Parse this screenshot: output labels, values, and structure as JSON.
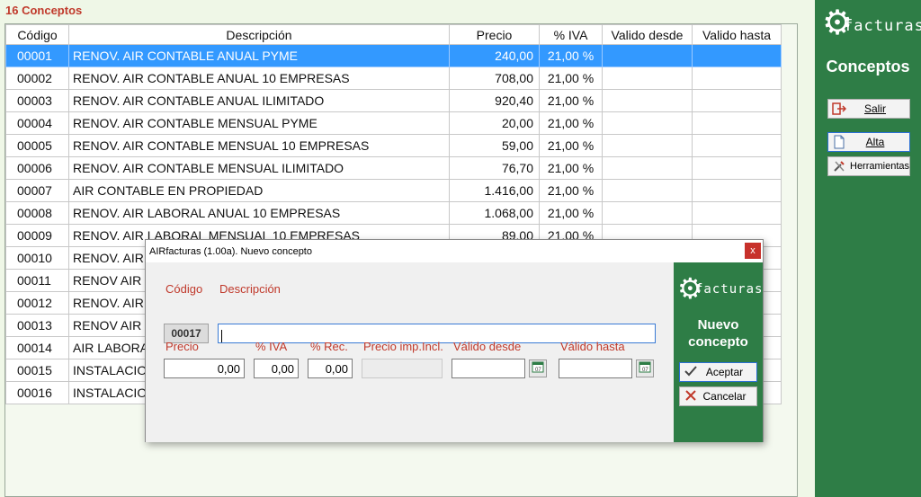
{
  "list": {
    "count_title": "16 Conceptos",
    "columns": [
      "Código",
      "Descripción",
      "Precio",
      "% IVA",
      "Valido desde",
      "Valido hasta"
    ],
    "rows": [
      {
        "code": "00001",
        "desc": "RENOV. AIR CONTABLE ANUAL PYME",
        "price": "240,00",
        "iva": "21,00 %"
      },
      {
        "code": "00002",
        "desc": "RENOV. AIR CONTABLE ANUAL 10 EMPRESAS",
        "price": "708,00",
        "iva": "21,00 %"
      },
      {
        "code": "00003",
        "desc": "RENOV. AIR CONTABLE ANUAL ILIMITADO",
        "price": "920,40",
        "iva": "21,00 %"
      },
      {
        "code": "00004",
        "desc": "RENOV. AIR CONTABLE MENSUAL PYME",
        "price": "20,00",
        "iva": "21,00 %"
      },
      {
        "code": "00005",
        "desc": "RENOV. AIR CONTABLE MENSUAL 10 EMPRESAS",
        "price": "59,00",
        "iva": "21,00 %"
      },
      {
        "code": "00006",
        "desc": "RENOV. AIR CONTABLE MENSUAL ILIMITADO",
        "price": "76,70",
        "iva": "21,00 %"
      },
      {
        "code": "00007",
        "desc": "AIR CONTABLE EN PROPIEDAD",
        "price": "1.416,00",
        "iva": "21,00 %"
      },
      {
        "code": "00008",
        "desc": "RENOV. AIR LABORAL ANUAL 10 EMPRESAS",
        "price": "1.068,00",
        "iva": "21,00 %"
      },
      {
        "code": "00009",
        "desc": "RENOV. AIR LABORAL MENSUAL 10 EMPRESAS",
        "price": "89,00",
        "iva": "21,00 %"
      },
      {
        "code": "00010",
        "desc": "RENOV. AIR",
        "price": "",
        "iva": ""
      },
      {
        "code": "00011",
        "desc": "RENOV AIR L",
        "price": "",
        "iva": ""
      },
      {
        "code": "00012",
        "desc": "RENOV. AIR",
        "price": "",
        "iva": ""
      },
      {
        "code": "00013",
        "desc": "RENOV AIR L",
        "price": "",
        "iva": ""
      },
      {
        "code": "00014",
        "desc": "AIR LABORA",
        "price": "",
        "iva": ""
      },
      {
        "code": "00015",
        "desc": "INSTALACION",
        "price": "",
        "iva": ""
      },
      {
        "code": "00016",
        "desc": "INSTALACION",
        "price": "",
        "iva": ""
      }
    ]
  },
  "sidebar": {
    "logo_text": "facturas",
    "title": "Conceptos",
    "buttons": {
      "salir": "Salir",
      "alta": "Alta",
      "herramientas": "Herramientas"
    }
  },
  "dialog": {
    "title": "AIRfacturas (1.00a). Nuevo concepto",
    "close": "x",
    "labels": {
      "codigo": "Código",
      "descripcion": "Descripción",
      "precio": "Precio",
      "iva": "% IVA",
      "rec": "% Rec.",
      "precio_incl": "Precio imp.Incl.",
      "valido_desde": "Válido desde",
      "valido_hasta": "Válido hasta"
    },
    "values": {
      "codigo": "00017",
      "descripcion": "",
      "precio": "0,00",
      "iva": "0,00",
      "rec": "0,00",
      "precio_incl": "",
      "valido_desde": "",
      "valido_hasta": ""
    },
    "side": {
      "logo_text": "facturas",
      "title_line1": "Nuevo",
      "title_line2": "concepto",
      "aceptar": "Aceptar",
      "cancelar": "Cancelar"
    }
  },
  "colors": {
    "accent_green": "#2e7d46",
    "selection_blue": "#3399ff",
    "label_red": "#c0392b"
  }
}
